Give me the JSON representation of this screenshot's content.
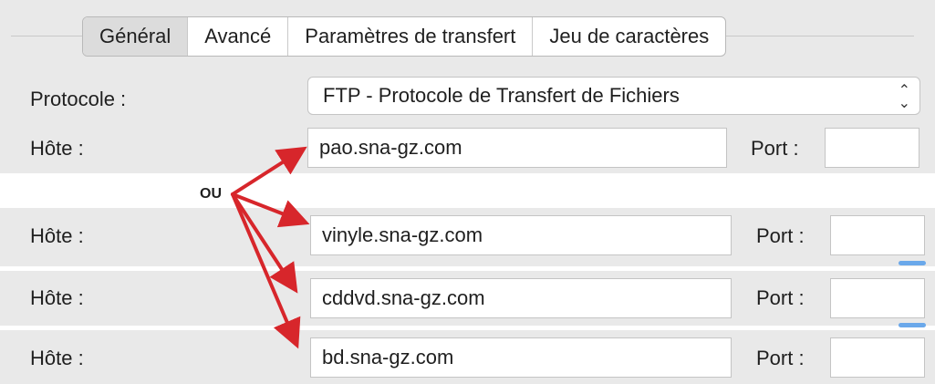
{
  "tabs": [
    {
      "label": "Général",
      "active": true
    },
    {
      "label": "Avancé",
      "active": false
    },
    {
      "label": "Paramètres de transfert",
      "active": false
    },
    {
      "label": "Jeu de caractères",
      "active": false
    }
  ],
  "protocol": {
    "label": "Protocole :",
    "value": "FTP - Protocole de Transfert de Fichiers",
    "icon": "chevron-updown-icon"
  },
  "hosts": [
    {
      "host_label": "Hôte :",
      "value": "pao.sna-gz.com",
      "port_label": "Port :",
      "port_value": ""
    },
    {
      "host_label": "Hôte :",
      "value": "vinyle.sna-gz.com",
      "port_label": "Port :",
      "port_value": ""
    },
    {
      "host_label": "Hôte :",
      "value": "cddvd.sna-gz.com",
      "port_label": "Port :",
      "port_value": ""
    },
    {
      "host_label": "Hôte :",
      "value": "bd.sna-gz.com",
      "port_label": "Port :",
      "port_value": ""
    }
  ],
  "annotation": {
    "separator_text": "OU",
    "arrow_color": "#d7262b"
  },
  "colors": {
    "panel_bg": "#e9e9e9",
    "accent_blue": "#6aa8ea"
  }
}
